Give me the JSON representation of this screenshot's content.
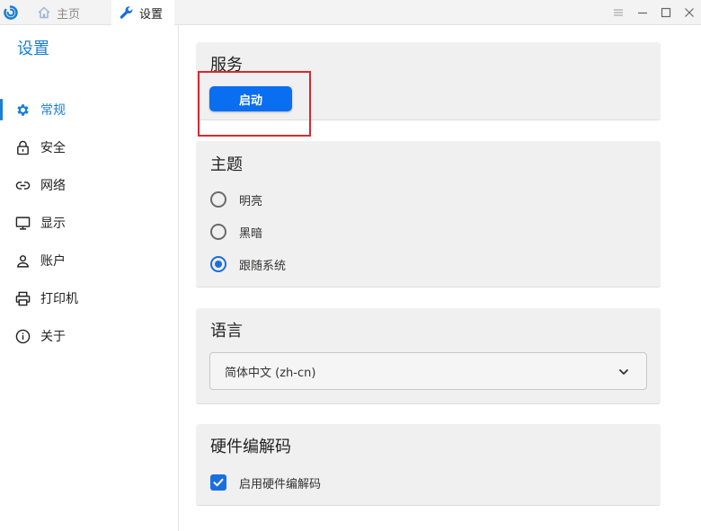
{
  "titlebar": {
    "tabs": [
      {
        "label": "主页",
        "icon": "home-icon"
      },
      {
        "label": "设置",
        "icon": "wrench-icon"
      }
    ],
    "controls": [
      "menu-icon",
      "minimize-icon",
      "maximize-icon",
      "close-icon"
    ]
  },
  "sidebar": {
    "title": "设置",
    "items": [
      {
        "label": "常规",
        "icon": "gear-icon",
        "active": true
      },
      {
        "label": "安全",
        "icon": "lock-icon"
      },
      {
        "label": "网络",
        "icon": "link-icon"
      },
      {
        "label": "显示",
        "icon": "monitor-icon"
      },
      {
        "label": "账户",
        "icon": "user-icon"
      },
      {
        "label": "打印机",
        "icon": "printer-icon"
      },
      {
        "label": "关于",
        "icon": "info-icon"
      }
    ]
  },
  "main": {
    "service": {
      "title": "服务",
      "start_label": "启动"
    },
    "theme": {
      "title": "主题",
      "options": [
        {
          "label": "明亮",
          "checked": false
        },
        {
          "label": "黑暗",
          "checked": false
        },
        {
          "label": "跟随系统",
          "checked": true
        }
      ]
    },
    "language": {
      "title": "语言",
      "selected": "简体中文 (zh-cn)"
    },
    "hardware": {
      "title": "硬件编解码",
      "enable_label": "启用硬件编解码",
      "enabled": true
    }
  },
  "colors": {
    "accent": "#1a7fd6",
    "button": "#0a6ef0",
    "highlight": "#d9282f",
    "card_bg": "#f0f0f0"
  }
}
